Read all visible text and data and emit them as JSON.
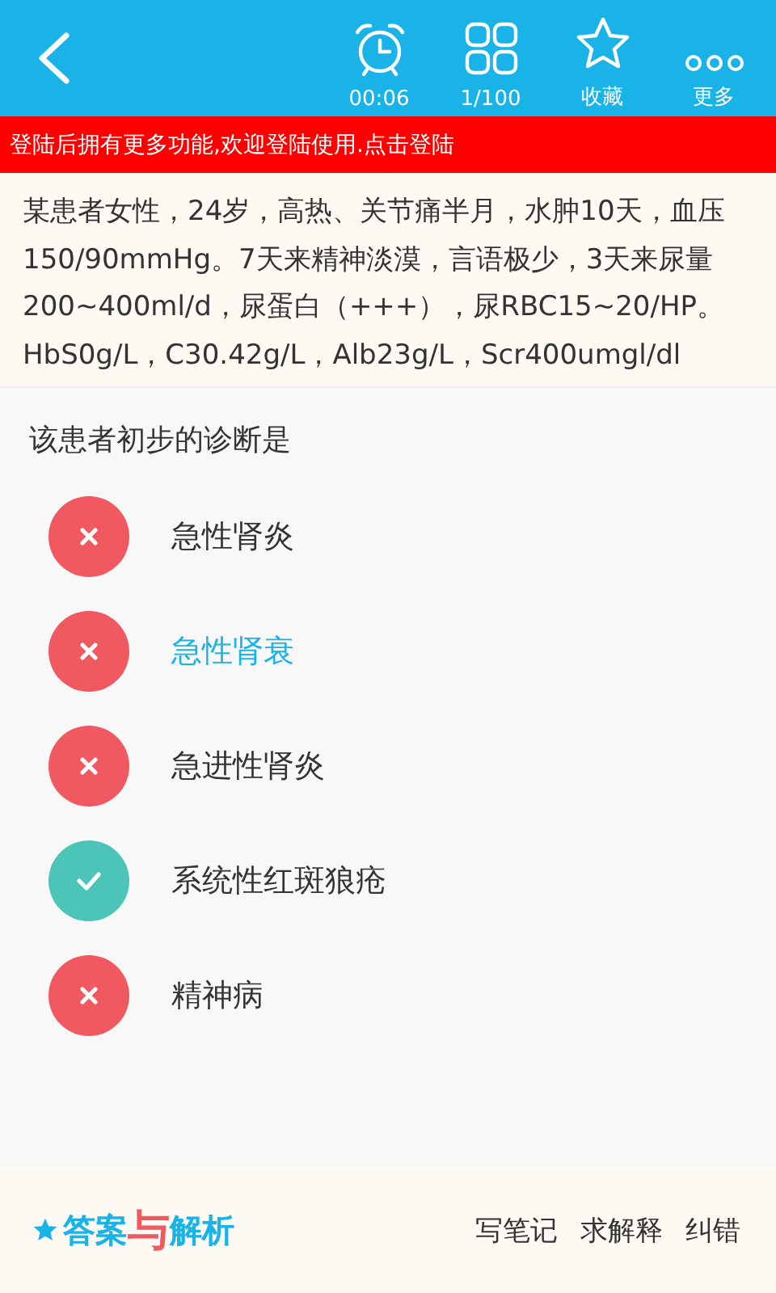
{
  "toolbar": {
    "items": [
      {
        "kind": "timer",
        "label": "00:06"
      },
      {
        "kind": "grid",
        "label": "1/100"
      },
      {
        "kind": "star",
        "label": "收藏"
      },
      {
        "kind": "more",
        "label": "更多"
      }
    ]
  },
  "login_banner": "登陆后拥有更多功能,欢迎登陆使用.点击登陆",
  "passage": "某患者女性，24岁，高热、关节痛半月，水肿10天，血压150/90mmHg。7天来精神淡漠，言语极少，3天来尿量200~400ml/d，尿蛋白（+++），尿RBC15~20/HP。HbS0g/L，C30.42g/L，Alb23g/L，Scr400umgl/dl",
  "question": "该患者初步的诊断是",
  "options": [
    {
      "label": "急性肾炎",
      "kind": "wrong",
      "selected": false
    },
    {
      "label": "急性肾衰",
      "kind": "wrong",
      "selected": true
    },
    {
      "label": "急进性肾炎",
      "kind": "wrong",
      "selected": false
    },
    {
      "label": "系统性红斑狼疮",
      "kind": "correct",
      "selected": false
    },
    {
      "label": "精神病",
      "kind": "wrong",
      "selected": false
    }
  ],
  "footer": {
    "title_parts": [
      "答案",
      "与",
      "解析"
    ],
    "actions": [
      "写笔记",
      "求解释",
      "纠错"
    ]
  }
}
